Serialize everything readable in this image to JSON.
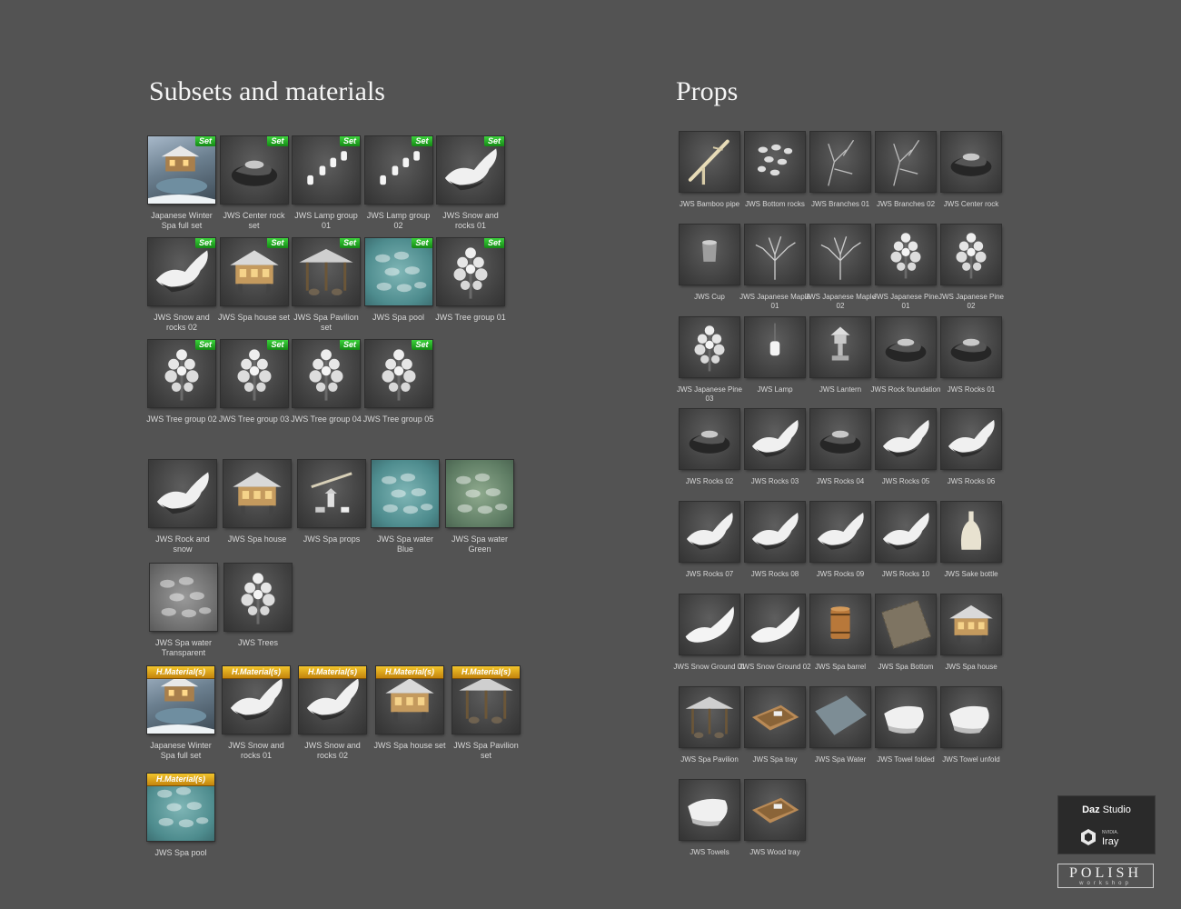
{
  "left_title": "Subsets and materials",
  "right_title": "Props",
  "badges": {
    "set": "Set",
    "material": "H.Material(s)"
  },
  "set_items": [
    {
      "label": "Japanese Winter Spa full set",
      "icon": "spa-full-set-icon",
      "style": "photo"
    },
    {
      "label": "JWS Center rock set",
      "icon": "rock-icon",
      "style": ""
    },
    {
      "label": "JWS Lamp group 01",
      "icon": "lamp-group-icon",
      "style": ""
    },
    {
      "label": "JWS Lamp group 02",
      "icon": "lamp-group-icon",
      "style": ""
    },
    {
      "label": "JWS Snow and rocks 01",
      "icon": "snow-rock-icon",
      "style": ""
    },
    {
      "label": "JWS Snow and rocks 02",
      "icon": "snow-rock-icon",
      "style": ""
    },
    {
      "label": "JWS Spa house set",
      "icon": "spa-house-icon",
      "style": ""
    },
    {
      "label": "JWS Spa Pavilion set",
      "icon": "pavilion-icon",
      "style": ""
    },
    {
      "label": "JWS Spa pool",
      "icon": "pool-icon",
      "style": "blue"
    },
    {
      "label": "JWS Tree group 01",
      "icon": "tree-icon",
      "style": ""
    },
    {
      "label": "JWS Tree group 02",
      "icon": "tree-icon",
      "style": ""
    },
    {
      "label": "JWS Tree group 03",
      "icon": "tree-icon",
      "style": ""
    },
    {
      "label": "JWS Tree group 04",
      "icon": "tree-icon",
      "style": ""
    },
    {
      "label": "JWS Tree group 05",
      "icon": "tree-icon",
      "style": ""
    }
  ],
  "subset_items": [
    {
      "label": "JWS Rock and snow",
      "icon": "snow-rock-icon",
      "style": ""
    },
    {
      "label": "JWS Spa house",
      "icon": "spa-house-icon",
      "style": ""
    },
    {
      "label": "JWS Spa props",
      "icon": "spa-props-icon",
      "style": ""
    },
    {
      "label": "JWS Spa water Blue",
      "icon": "pool-icon",
      "style": "blue"
    },
    {
      "label": "JWS Spa water Green",
      "icon": "pool-icon",
      "style": "green"
    },
    {
      "label": "JWS Spa water Transparent",
      "icon": "pool-icon",
      "style": "gray"
    },
    {
      "label": "JWS Trees",
      "icon": "tree-icon",
      "style": ""
    }
  ],
  "material_items": [
    {
      "label": "Japanese Winter Spa full set",
      "icon": "spa-full-set-icon",
      "style": "photo"
    },
    {
      "label": "JWS Snow and rocks 01",
      "icon": "snow-rock-icon",
      "style": ""
    },
    {
      "label": "JWS Snow and rocks 02",
      "icon": "snow-rock-icon",
      "style": ""
    },
    {
      "label": "JWS Spa house set",
      "icon": "spa-house-icon",
      "style": ""
    },
    {
      "label": "JWS Spa Pavilion set",
      "icon": "pavilion-icon",
      "style": ""
    },
    {
      "label": "JWS Spa pool",
      "icon": "pool-icon",
      "style": "blue"
    }
  ],
  "props": [
    {
      "label": "JWS Bamboo pipe",
      "icon": "bamboo-pipe-icon"
    },
    {
      "label": "JWS Bottom rocks",
      "icon": "pebbles-icon"
    },
    {
      "label": "JWS Branches 01",
      "icon": "branches-icon"
    },
    {
      "label": "JWS Branches 02",
      "icon": "branches-icon"
    },
    {
      "label": "JWS Center rock",
      "icon": "rock-icon"
    },
    {
      "label": "JWS Cup",
      "icon": "cup-icon"
    },
    {
      "label": "JWS Japanese Maple 01",
      "icon": "maple-icon"
    },
    {
      "label": "JWS Japanese Maple 02",
      "icon": "maple-icon"
    },
    {
      "label": "JWS Japanese Pine 01",
      "icon": "tree-icon"
    },
    {
      "label": "JWS Japanese Pine 02",
      "icon": "tree-icon"
    },
    {
      "label": "JWS Japanese Pine 03",
      "icon": "tree-icon"
    },
    {
      "label": "JWS Lamp",
      "icon": "lamp-icon"
    },
    {
      "label": "JWS Lantern",
      "icon": "lantern-icon"
    },
    {
      "label": "JWS Rock foundation",
      "icon": "rock-icon"
    },
    {
      "label": "JWS Rocks 01",
      "icon": "rock-icon"
    },
    {
      "label": "JWS Rocks 02",
      "icon": "rock-icon"
    },
    {
      "label": "JWS Rocks 03",
      "icon": "snow-rock-icon"
    },
    {
      "label": "JWS Rocks 04",
      "icon": "rock-icon"
    },
    {
      "label": "JWS Rocks 05",
      "icon": "snow-rock-icon"
    },
    {
      "label": "JWS Rocks 06",
      "icon": "snow-rock-icon"
    },
    {
      "label": "JWS Rocks 07",
      "icon": "snow-rock-icon"
    },
    {
      "label": "JWS Rocks 08",
      "icon": "snow-rock-icon"
    },
    {
      "label": "JWS Rocks 09",
      "icon": "snow-rock-icon"
    },
    {
      "label": "JWS Rocks 10",
      "icon": "snow-rock-icon"
    },
    {
      "label": "JWS Sake bottle",
      "icon": "bottle-icon"
    },
    {
      "label": "JWS Snow Ground 01",
      "icon": "snow-ground-icon"
    },
    {
      "label": "JWS Snow Ground 02",
      "icon": "snow-ground-icon"
    },
    {
      "label": "JWS Spa barrel",
      "icon": "barrel-icon"
    },
    {
      "label": "JWS Spa Bottom",
      "icon": "tile-icon"
    },
    {
      "label": "JWS Spa house",
      "icon": "spa-house-icon"
    },
    {
      "label": "JWS Spa Pavilion",
      "icon": "pavilion-icon"
    },
    {
      "label": "JWS Spa tray",
      "icon": "tray-icon"
    },
    {
      "label": "JWS Spa Water",
      "icon": "water-plane-icon"
    },
    {
      "label": "JWS Towel folded",
      "icon": "towel-icon"
    },
    {
      "label": "JWS Towel unfold",
      "icon": "towel-icon"
    },
    {
      "label": "JWS Towels",
      "icon": "towel-icon"
    },
    {
      "label": "JWS Wood tray",
      "icon": "tray-icon"
    }
  ],
  "logos": {
    "daz_bold": "Daz",
    "daz_rest": " Studio",
    "nvidia": "NVIDIA.",
    "iray": "Iray",
    "polish": "POLISH",
    "workshop": "workshop"
  }
}
